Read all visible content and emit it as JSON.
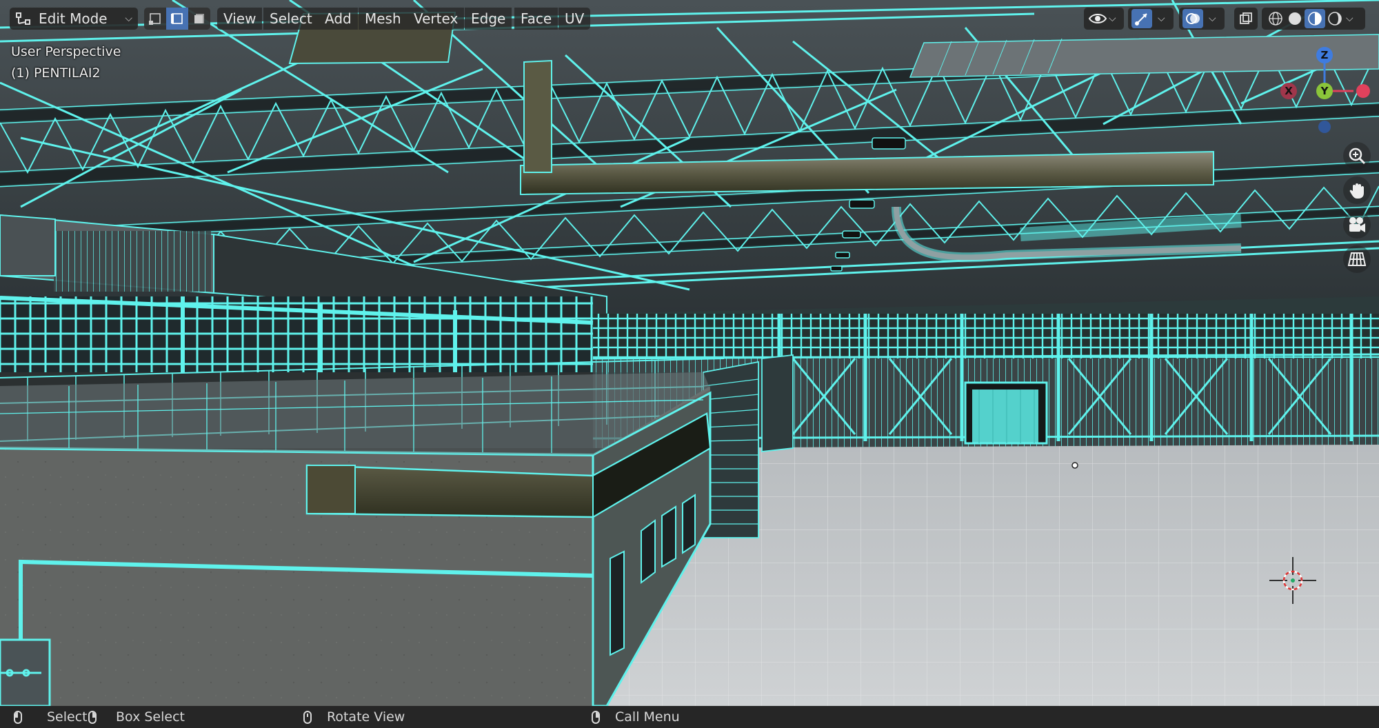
{
  "header": {
    "mode_selector": {
      "label": "Edit Mode",
      "icon": "edit-mode-icon"
    },
    "select_modes": [
      "vertex-select-icon",
      "edge-select-icon",
      "face-select-icon"
    ],
    "active_select_mode": "edge-select-icon",
    "menus": [
      "View",
      "Select",
      "Add",
      "Mesh",
      "Vertex",
      "Edge",
      "Face",
      "UV"
    ],
    "right_tools": [
      "visibility-icon",
      "gizmo-icon",
      "overlay-icon",
      "xray-icon",
      "wireframe-shading-icon",
      "solid-shading-icon",
      "material-shading-icon",
      "rendered-shading-icon"
    ]
  },
  "viewport": {
    "view_name": "User Perspective",
    "object_name": "(1) PENTILAI2",
    "gizmo_axes": {
      "z": "Z",
      "y": "Y",
      "x": "X"
    },
    "nav_buttons": [
      "zoom-icon",
      "pan-hand-icon",
      "camera-view-icon",
      "ortho-grid-icon"
    ]
  },
  "statusbar": {
    "items": [
      {
        "icon": "mouse-left-icon",
        "label": "Select"
      },
      {
        "icon": "mouse-right-drag-icon",
        "label": "Box Select"
      },
      {
        "icon": "mouse-middle-icon",
        "label": "Rotate View"
      },
      {
        "icon": "mouse-right-icon",
        "label": "Call Menu"
      }
    ]
  },
  "colors": {
    "wire": "#5ff2ec",
    "accent": "#4772b3",
    "header_bg": "#282828",
    "status_bg": "#262626",
    "floor": "#c2c5c7",
    "axis_x": "#e0415c",
    "axis_y": "#8bc53a",
    "axis_z": "#3f7ce0"
  }
}
